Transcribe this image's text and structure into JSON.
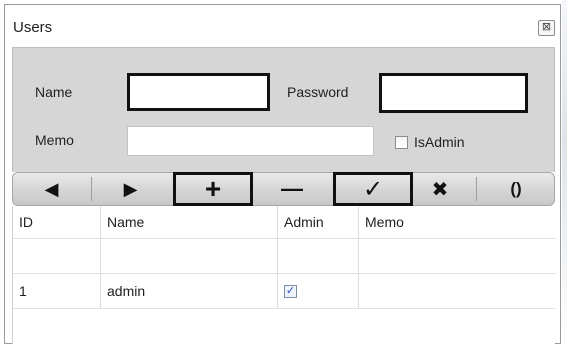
{
  "window": {
    "title": "Users",
    "close_icon": "close-icon"
  },
  "form": {
    "name_label": "Name",
    "name_value": "",
    "password_label": "Password",
    "password_value": "",
    "memo_label": "Memo",
    "memo_value": "",
    "isadmin_label": "IsAdmin",
    "isadmin_checked": false
  },
  "toolbar": {
    "buttons": [
      {
        "name": "previous-button",
        "icon": "triangle-left-icon",
        "glyph": "◀"
      },
      {
        "name": "next-button",
        "icon": "triangle-right-icon",
        "glyph": "▶"
      },
      {
        "name": "add-button",
        "icon": "plus-icon",
        "glyph": "+"
      },
      {
        "name": "delete-button",
        "icon": "minus-icon",
        "glyph": "—"
      },
      {
        "name": "save-button",
        "icon": "checkmark-icon",
        "glyph": "✓"
      },
      {
        "name": "cancel-button",
        "icon": "x-icon",
        "glyph": "✖"
      },
      {
        "name": "refresh-button",
        "icon": "refresh-icon",
        "glyph": "()"
      }
    ]
  },
  "grid": {
    "columns": [
      "ID",
      "Name",
      "Admin",
      "Memo"
    ],
    "rows": [
      {
        "id": "",
        "name": "",
        "admin": null,
        "memo": ""
      },
      {
        "id": "1",
        "name": "admin",
        "admin": true,
        "memo": ""
      }
    ]
  }
}
